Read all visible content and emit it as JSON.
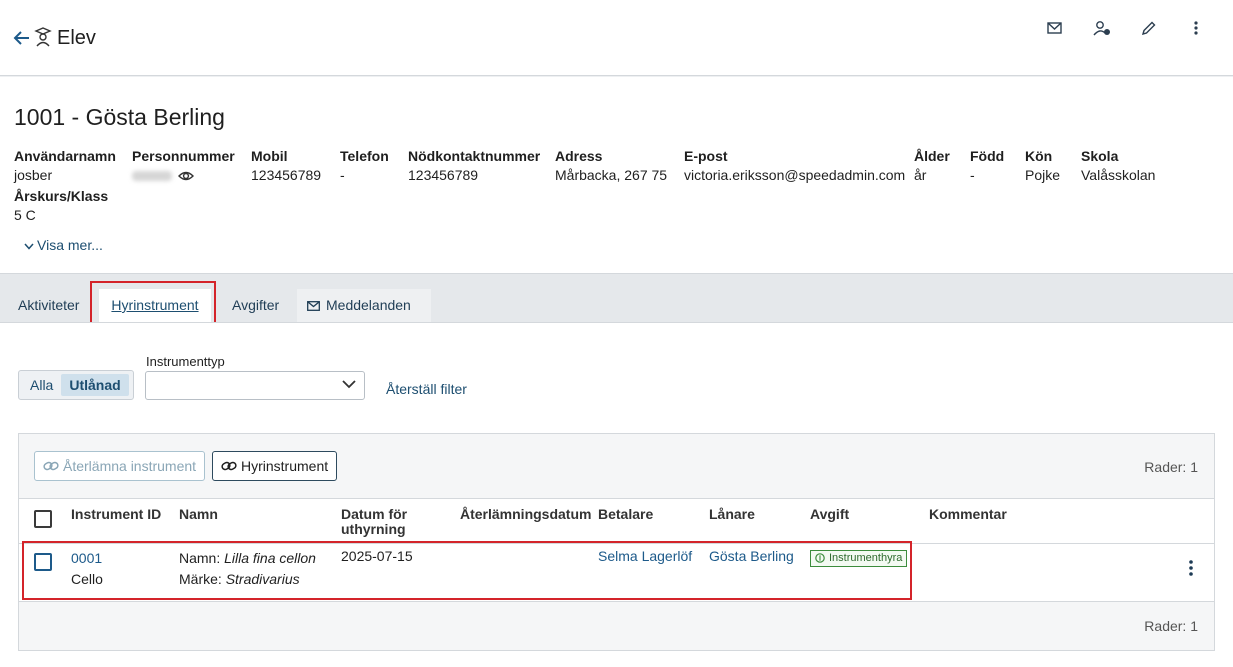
{
  "header": {
    "title": "Elev"
  },
  "student": {
    "name": "1001 - Gösta Berling",
    "fields": {
      "username": {
        "label": "Användarnamn",
        "value": "josber"
      },
      "personnummer": {
        "label": "Personnummer",
        "value": ""
      },
      "mobil": {
        "label": "Mobil",
        "value": "123456789"
      },
      "telefon": {
        "label": "Telefon",
        "value": "-"
      },
      "nodkontakt": {
        "label": "Nödkontaktnummer",
        "value": "123456789"
      },
      "adress": {
        "label": "Adress",
        "value": "Mårbacka, 267 75"
      },
      "epost": {
        "label": "E-post",
        "value": "victoria.eriksson@speedadmin.com"
      },
      "alder": {
        "label": "Ålder",
        "value": "år"
      },
      "fodd": {
        "label": "Född",
        "value": "-"
      },
      "kon": {
        "label": "Kön",
        "value": "Pojke"
      },
      "skola": {
        "label": "Skola",
        "value": "Valåsskolan"
      },
      "klass": {
        "label": "Årskurs/Klass",
        "value": "5 C"
      }
    },
    "show_more": "Visa mer..."
  },
  "tabs": [
    {
      "label": "Aktiviteter"
    },
    {
      "label": "Hyrinstrument"
    },
    {
      "label": "Avgifter"
    },
    {
      "label": "Meddelanden"
    }
  ],
  "filters": {
    "toggle": [
      "Alla",
      "Utlånad"
    ],
    "instrument_type_label": "Instrumenttyp",
    "instrument_type_value": "",
    "reset": "Återställ filter"
  },
  "table": {
    "buttons": {
      "return": "Återlämna instrument",
      "rent": "Hyrinstrument"
    },
    "rows_label_top": "Rader: 1",
    "rows_label_bottom": "Rader: 1",
    "columns": {
      "id": "Instrument ID",
      "name": "Namn",
      "date_1": "Datum för",
      "date_2": "uthyrning",
      "return_date": "Återlämningsdatum",
      "payer": "Betalare",
      "borrower": "Lånare",
      "fee": "Avgift",
      "comment": "Kommentar"
    },
    "rows": [
      {
        "id": "0001",
        "type": "Cello",
        "name_label": "Namn:",
        "name_value": "Lilla fina cellon",
        "brand_label": "Märke:",
        "brand_value": "Stradivarius",
        "date": "2025-07-15",
        "return_date": "",
        "payer": "Selma Lagerlöf",
        "borrower": "Gösta Berling",
        "fee": "Instrumenthyra",
        "comment": ""
      }
    ]
  },
  "colors": {
    "accent": "#1d5a8a",
    "highlight": "#d4242a",
    "fee_badge": "#3c8c3c"
  }
}
